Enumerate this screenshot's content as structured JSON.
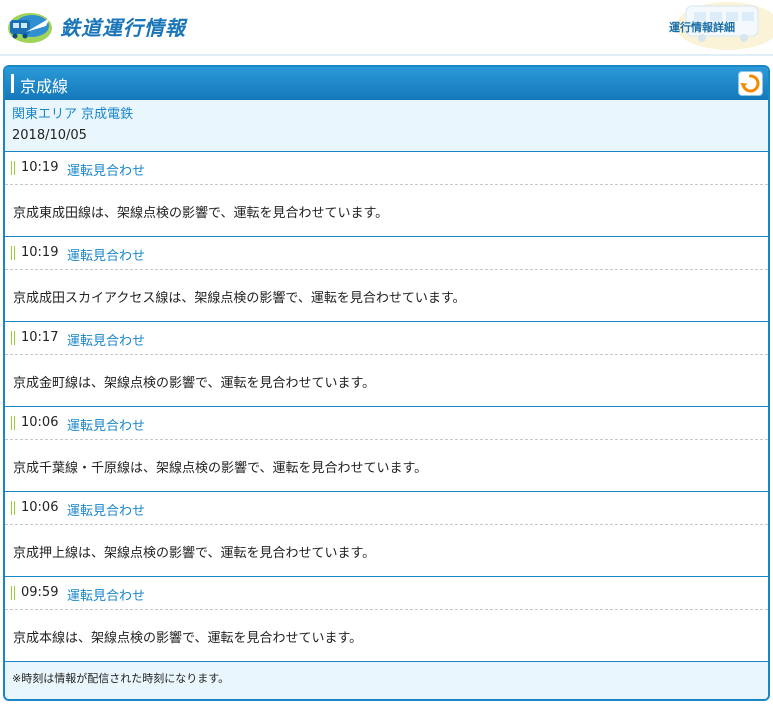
{
  "header": {
    "site_title": "鉄道運行情報",
    "detail_link": "運行情報詳細"
  },
  "panel": {
    "title": "京成線",
    "area_name": "関東エリア 京成電鉄",
    "date": "2018/10/05",
    "entries": [
      {
        "time": "10:19",
        "status": "運転見合わせ",
        "message": "京成東成田線は、架線点検の影響で、運転を見合わせています。"
      },
      {
        "time": "10:19",
        "status": "運転見合わせ",
        "message": "京成成田スカイアクセス線は、架線点検の影響で、運転を見合わせています。"
      },
      {
        "time": "10:17",
        "status": "運転見合わせ",
        "message": "京成金町線は、架線点検の影響で、運転を見合わせています。"
      },
      {
        "time": "10:06",
        "status": "運転見合わせ",
        "message": "京成千葉線・千原線は、架線点検の影響で、運転を見合わせています。"
      },
      {
        "time": "10:06",
        "status": "運転見合わせ",
        "message": "京成押上線は、架線点検の影響で、運転を見合わせています。"
      },
      {
        "time": "09:59",
        "status": "運転見合わせ",
        "message": "京成本線は、架線点検の影響で、運転を見合わせています。"
      }
    ],
    "note": "※時刻は情報が配信された時刻になります。"
  },
  "colors": {
    "accent": "#1a86c8",
    "status_link": "#1a86c8",
    "area_bg": "#eaf6fd",
    "marker": "#9acd32"
  }
}
